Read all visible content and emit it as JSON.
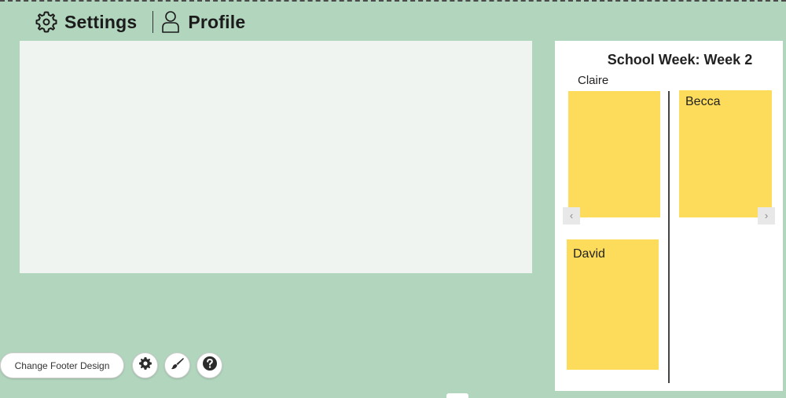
{
  "header": {
    "settings_label": "Settings",
    "settings_icon": "gear-outline-icon",
    "profile_label": "Profile",
    "profile_icon": "user-outline-icon"
  },
  "panel": {
    "title": "School Week: Week 2",
    "notes": [
      {
        "name": "Claire",
        "label": "Claire"
      },
      {
        "name": "Becca",
        "label": "Becca"
      },
      {
        "name": "David",
        "label": "David"
      }
    ],
    "note_color": "#fedc5b",
    "prev_arrow": "‹",
    "next_arrow": "›"
  },
  "footer": {
    "change_design_label": "Change Footer Design",
    "icons": [
      "gear-icon",
      "brush-icon",
      "help-icon"
    ]
  },
  "colors": {
    "background": "#b2d5bd",
    "canvas": "#eff4f0",
    "panel": "#ffffff"
  }
}
